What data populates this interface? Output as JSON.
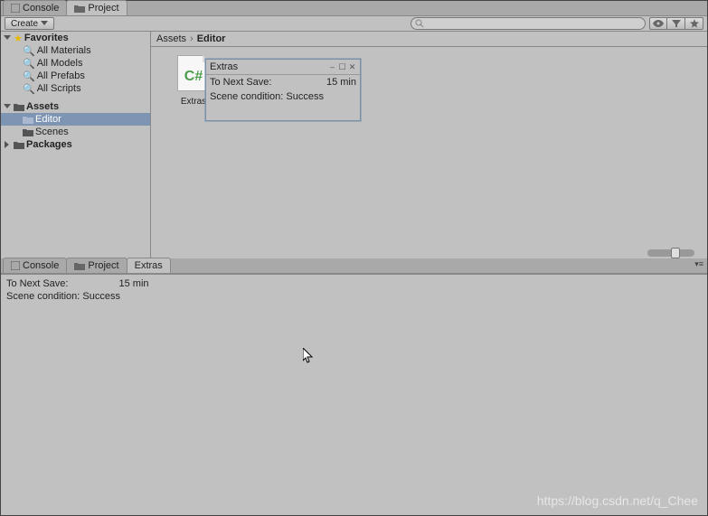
{
  "topTabs": {
    "console": "Console",
    "project": "Project"
  },
  "toolbar": {
    "create": "Create"
  },
  "sidebar": {
    "favorites": "Favorites",
    "fav_items": [
      "All Materials",
      "All Models",
      "All Prefabs",
      "All Scripts"
    ],
    "assets": "Assets",
    "assets_items": [
      "Editor",
      "Scenes"
    ],
    "packages": "Packages"
  },
  "breadcrumb": {
    "root": "Assets",
    "current": "Editor"
  },
  "asset": {
    "lang": "C#",
    "name": "Extras"
  },
  "popup": {
    "title": "Extras",
    "rows": [
      {
        "label": "To Next Save:",
        "value": "15 min"
      },
      {
        "label": "Scene condition: Success",
        "value": ""
      }
    ]
  },
  "bottomTabs": {
    "console": "Console",
    "project": "Project",
    "extras": "Extras"
  },
  "bottomInfo": [
    {
      "label": "To Next Save:",
      "value": "15 min"
    },
    {
      "label": "Scene condition: Success",
      "value": ""
    }
  ],
  "watermark": "https://blog.csdn.net/q_Chee"
}
